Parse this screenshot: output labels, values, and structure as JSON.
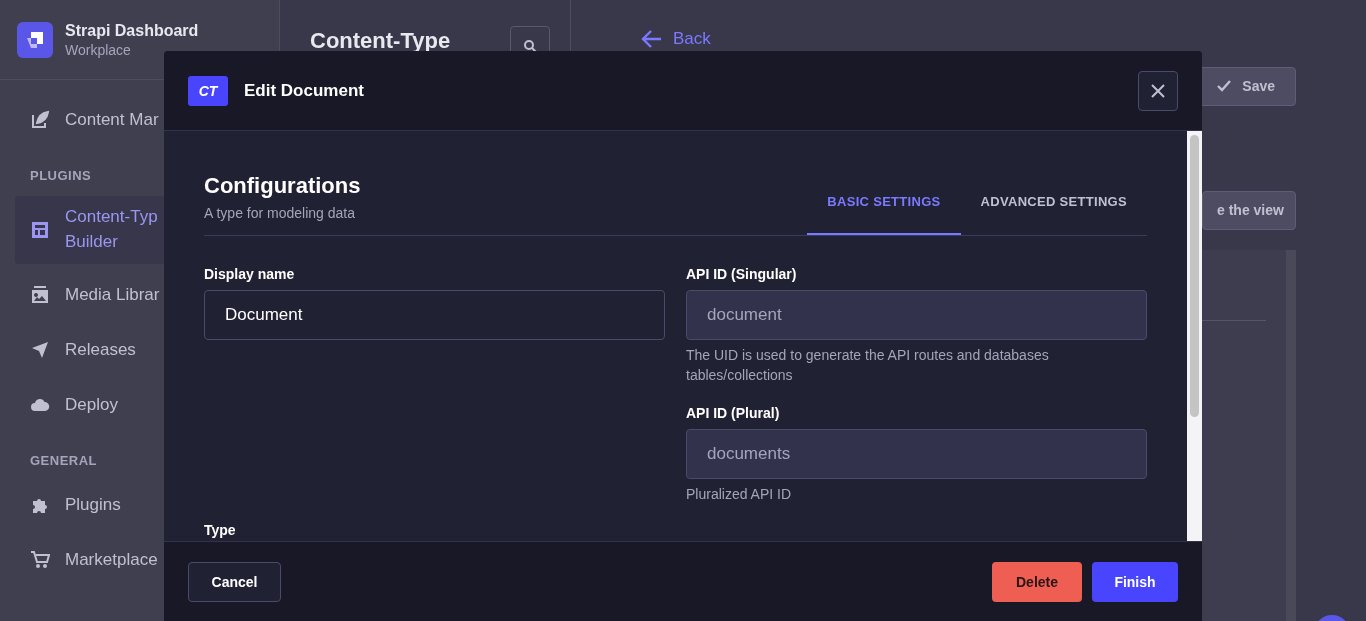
{
  "sidebar": {
    "brand": {
      "title": "Strapi Dashboard",
      "subtitle": "Workplace"
    },
    "sections": [
      {
        "items": [
          {
            "label": "Content Mar",
            "selected": false
          }
        ]
      },
      {
        "heading": "PLUGINS",
        "items": [
          {
            "label": "Content-Typ\nBuilder",
            "selected": true
          },
          {
            "label": "Media Librar",
            "selected": false
          },
          {
            "label": "Releases",
            "selected": false
          },
          {
            "label": "Deploy",
            "selected": false
          }
        ]
      },
      {
        "heading": "GENERAL",
        "items": [
          {
            "label": "Plugins",
            "selected": false
          },
          {
            "label": "Marketplace",
            "selected": false
          }
        ]
      }
    ]
  },
  "content_panel": {
    "title": "Content-Type"
  },
  "main": {
    "back": "Back",
    "save": "Save",
    "view_button": "e the view"
  },
  "modal": {
    "badge": "CT",
    "title": "Edit Document",
    "heading": "Configurations",
    "subheading": "A type for modeling data",
    "tabs": [
      {
        "label": "BASIC SETTINGS",
        "selected": true
      },
      {
        "label": "ADVANCED SETTINGS",
        "selected": false
      }
    ],
    "left_fields": [
      {
        "label": "Display name",
        "value": "Document",
        "disabled": false
      }
    ],
    "right_fields": [
      {
        "label": "API ID (Singular)",
        "value": "document",
        "disabled": true,
        "hint": "The UID is used to generate the API routes and databases tables/collections"
      },
      {
        "label": "API ID (Plural)",
        "value": "documents",
        "disabled": true,
        "hint": "Pluralized API ID"
      }
    ],
    "type_label": "Type",
    "buttons": [
      {
        "label": "Cancel",
        "kind": "secondary"
      },
      {
        "label": "Delete",
        "kind": "danger"
      },
      {
        "label": "Finish",
        "kind": "primary"
      }
    ]
  }
}
